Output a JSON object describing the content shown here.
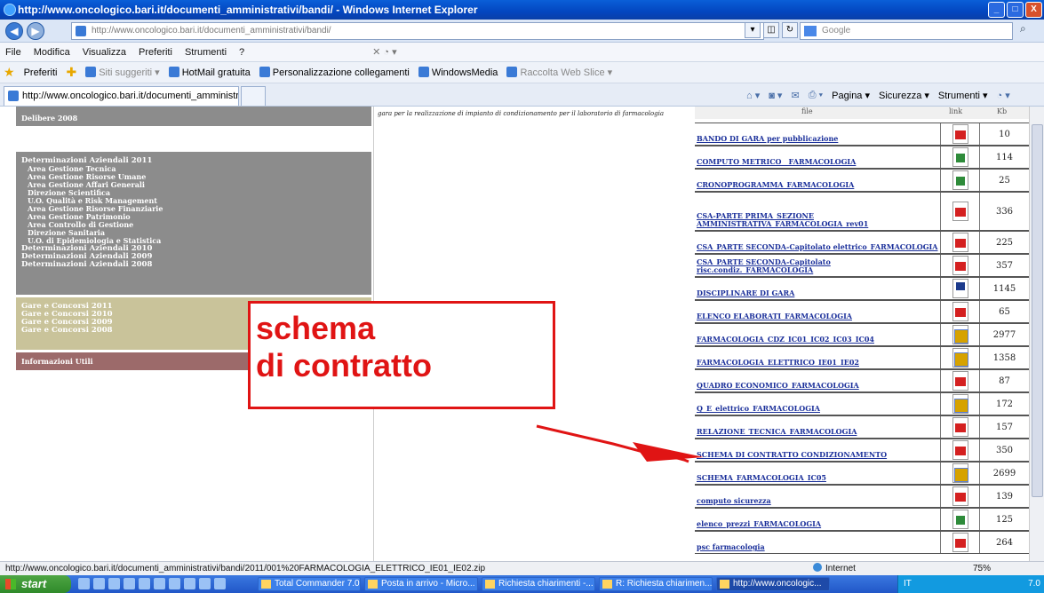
{
  "window": {
    "title": "http://www.oncologico.bari.it/documenti_amministrativi/bandi/ - Windows Internet Explorer",
    "min": "_",
    "max": "□",
    "close": "X"
  },
  "address": {
    "url": "http://www.oncologico.bari.it/documenti_amministrativi/bandi/",
    "search_placeholder": "Google"
  },
  "menu": [
    "File",
    "Modifica",
    "Visualizza",
    "Preferiti",
    "Strumenti",
    "?"
  ],
  "favorites": {
    "label": "Preferiti",
    "items": [
      "Siti suggeriti ▾",
      "HotMail gratuita",
      "Personalizzazione collegamenti",
      "WindowsMedia",
      "Raccolta Web Slice ▾"
    ]
  },
  "tab": {
    "label": "http://www.oncologico.bari.it/documenti_amministrati..."
  },
  "command": [
    "Pagina ▾",
    "Sicurezza ▾",
    "Strumenti ▾"
  ],
  "left_menu": {
    "delibere": "Delibere 2008",
    "determinazioni": {
      "title": "Determinazioni Aziendali 2011",
      "subs": [
        "Area Gestione Tecnica",
        "Area Gestione Risorse Umane",
        "Area Gestione Affari Generali",
        "Direzione Scientifica",
        "U.O. Qualità e Risk Management",
        "Area Gestione Risorse Finanziarie",
        "Area Gestione Patrimonio",
        "Area Controllo di Gestione",
        "Direzione Sanitaria",
        "U.O. di Epidemiologia e Statistica"
      ],
      "others": [
        "Determinazioni Aziendali 2010",
        "Determinazioni Aziendali 2009",
        "Determinazioni Aziendali 2008"
      ]
    },
    "gare": [
      "Gare e Concorsi 2011",
      "Gare e Concorsi 2010",
      "Gare e Concorsi 2009",
      "Gare e Concorsi 2008"
    ],
    "info": "Informazioni Utili"
  },
  "middle_text": "gara per la realizzazione di impianto di condizionamento per il laboratorio di farmacologia",
  "table": {
    "headers": [
      "file",
      "link",
      "Kb"
    ],
    "rows": [
      {
        "name": "BANDO DI GARA per pubblicazione",
        "icon": "pdf",
        "size": "10"
      },
      {
        "name": "COMPUTO METRICO__FARMACOLOGIA",
        "icon": "xls",
        "size": "114"
      },
      {
        "name": "CRONOPROGRAMMA_FARMACOLOGIA",
        "icon": "xls",
        "size": "25"
      },
      {
        "name": "CSA-PARTE PRIMA_SEZIONE AMMINISTRATIVA_FARMACOLOGIA_rev01",
        "icon": "pdf",
        "size": "336"
      },
      {
        "name": "CSA_PARTE SECONDA-Capitolato elettrico_FARMACOLOGIA",
        "icon": "pdf",
        "size": "225"
      },
      {
        "name": "CSA_PARTE SECONDA-Capitolato risc.condiz._FARMACOLOGIA",
        "icon": "pdf",
        "size": "357"
      },
      {
        "name": "DISCIPLINARE DI GARA",
        "icon": "word",
        "size": "1145"
      },
      {
        "name": "ELENCO ELABORATI_FARMACOLOGIA",
        "icon": "pdf",
        "size": "65"
      },
      {
        "name": "FARMACOLOGIA_CDZ_IC01_IC02_IC03_IC04",
        "icon": "zip",
        "size": "2977"
      },
      {
        "name": "FARMACOLOGIA_ELETTRICO_IE01_IE02",
        "icon": "zip",
        "size": "1358"
      },
      {
        "name": "QUADRO ECONOMICO_FARMACOLOGIA",
        "icon": "pdf",
        "size": "87"
      },
      {
        "name": "Q_E_elettrico_FARMACOLOGIA",
        "icon": "zip",
        "size": "172"
      },
      {
        "name": "RELAZIONE_TECNICA_FARMACOLOGIA",
        "icon": "pdf",
        "size": "157"
      },
      {
        "name": "SCHEMA DI CONTRATTO CONDIZIONAMENTO",
        "icon": "pdf",
        "size": "350"
      },
      {
        "name": "SCHEMA_FARMACOLOGIA_IC05",
        "icon": "zip",
        "size": "2699"
      },
      {
        "name": "computo sicurezza",
        "icon": "pdf",
        "size": "139"
      },
      {
        "name": "elenco_prezzi_FARMACOLOGIA",
        "icon": "xls",
        "size": "125"
      },
      {
        "name": "psc farmacologia",
        "icon": "pdf",
        "size": "264"
      }
    ]
  },
  "annotation": {
    "line1": "schema",
    "line2": "di contratto",
    "color": "#e01414"
  },
  "status": {
    "text": "http://www.oncologico.bari.it/documenti_amministrativi/bandi/2011/001%20FARMACOLOGIA_ELETTRICO_IE01_IE02.zip",
    "zone": "Internet",
    "zoom": "75%"
  },
  "taskbar": {
    "start": "start",
    "tasks": [
      "Total Commander 7.0...",
      "Posta in arrivo - Micro...",
      "Richiesta chiarimenti -...",
      "R: Richiesta chiarimen...",
      "http://www.oncologic..."
    ],
    "tray": "IT",
    "clock": "7.0"
  }
}
